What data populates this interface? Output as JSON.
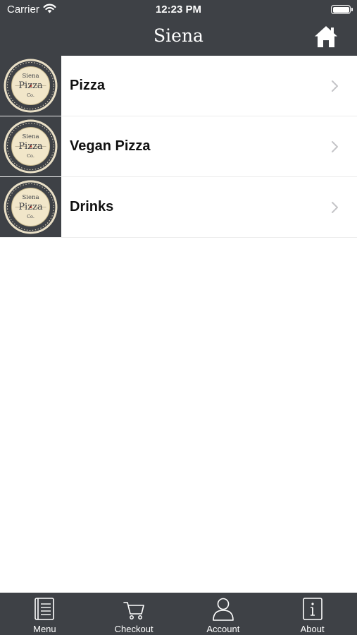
{
  "status_bar": {
    "carrier": "Carrier",
    "time": "12:23 PM"
  },
  "nav": {
    "title": "Siena",
    "home_icon": "home-icon"
  },
  "logo": {
    "top": "Siena",
    "main": "Pizza",
    "bottom": "Co.",
    "ring_text": "HOMEMADE SIENA PIZZA CO."
  },
  "menu": {
    "items": [
      {
        "label": "Pizza"
      },
      {
        "label": "Vegan Pizza"
      },
      {
        "label": "Drinks"
      }
    ]
  },
  "tabs": [
    {
      "label": "Menu",
      "icon": "menu-book-icon"
    },
    {
      "label": "Checkout",
      "icon": "cart-icon"
    },
    {
      "label": "Account",
      "icon": "person-icon"
    },
    {
      "label": "About",
      "icon": "info-icon"
    }
  ],
  "colors": {
    "bar": "#3e4146",
    "text": "#111111",
    "logo_cream": "#f1e6c9",
    "logo_red": "#b5322c"
  }
}
